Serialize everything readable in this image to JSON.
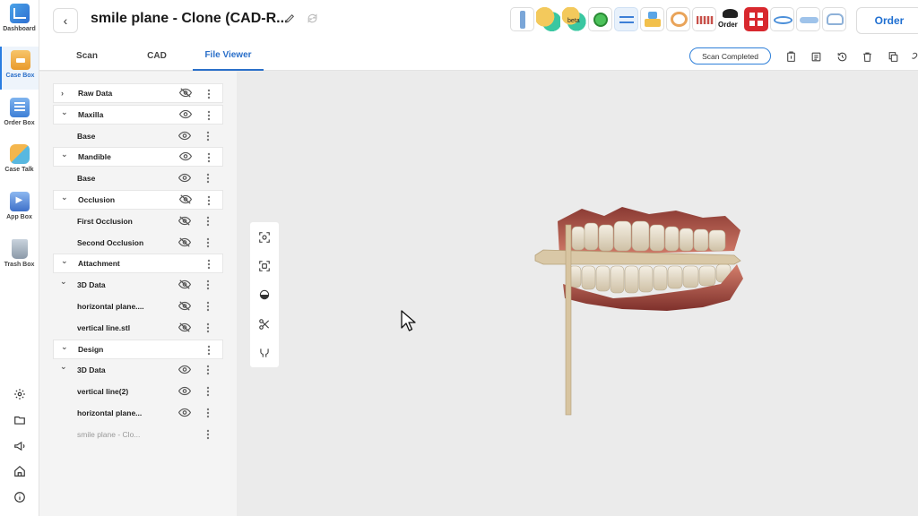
{
  "nav": {
    "items": [
      {
        "label": "Dashboard",
        "icon": "dashboard-icon"
      },
      {
        "label": "Case Box",
        "icon": "case-box-icon",
        "active": true
      },
      {
        "label": "Order Box",
        "icon": "order-box-icon"
      },
      {
        "label": "Case Talk",
        "icon": "case-talk-icon"
      },
      {
        "label": "App Box",
        "icon": "app-box-icon"
      },
      {
        "label": "Trash Box",
        "icon": "trash-box-icon"
      }
    ],
    "bottom_icons": [
      "settings-icon",
      "folder-icon",
      "megaphone-icon",
      "home-icon",
      "info-icon"
    ]
  },
  "header": {
    "back_icon": "chevron-left-icon",
    "title": "smile plane - Clone (CAD-R...",
    "edit_icon": "pencil-icon",
    "sync_icon": "sync-icon",
    "app_strip": [
      "app-scanner-icon",
      "app-green-icon",
      "app-beta-icon",
      "app-green-smile-icon",
      "app-workflow-icon",
      "app-ortho-icon",
      "app-arch-icon",
      "app-ruler-icon",
      "app-order-icon",
      "app-red-grid-icon",
      "app-lips-icon",
      "app-tray-icon",
      "app-tooth-icon"
    ],
    "beta_label": "beta",
    "order_app_label": "Order",
    "order_button": "Order"
  },
  "tabs": {
    "items": [
      "Scan",
      "CAD",
      "File Viewer"
    ],
    "active": "File Viewer",
    "status": "Scan Completed",
    "tool_icons": [
      "clipboard-icon",
      "note-icon",
      "history-icon",
      "delete-icon",
      "copy-icon",
      "link-icon"
    ]
  },
  "tree": [
    {
      "label": "Raw Data",
      "type": "group",
      "chevron": "chevron-right-icon",
      "eye": "eye-off"
    },
    {
      "label": "Maxilla",
      "type": "group",
      "chevron": "chevron-down-icon",
      "eye": "eye"
    },
    {
      "label": "Base",
      "type": "child",
      "eye": "eye"
    },
    {
      "label": "Mandible",
      "type": "group",
      "chevron": "chevron-down-icon",
      "eye": "eye"
    },
    {
      "label": "Base",
      "type": "child",
      "eye": "eye"
    },
    {
      "label": "Occlusion",
      "type": "group",
      "chevron": "chevron-down-icon",
      "eye": "eye-off"
    },
    {
      "label": "First Occlusion",
      "type": "child",
      "eye": "eye-off"
    },
    {
      "label": "Second Occlusion",
      "type": "child",
      "eye": "eye-off"
    },
    {
      "label": "Attachment",
      "type": "group",
      "chevron": "chevron-down-icon",
      "eye": "none"
    },
    {
      "label": "3D Data",
      "type": "subgroup",
      "chevron": "chevron-down-icon",
      "eye": "eye-off"
    },
    {
      "label": "horizontal plane....",
      "type": "child",
      "eye": "eye-off"
    },
    {
      "label": "vertical line.stl",
      "type": "child",
      "eye": "eye-off"
    },
    {
      "label": "Design",
      "type": "group",
      "chevron": "chevron-down-icon",
      "eye": "none"
    },
    {
      "label": "3D Data",
      "type": "subgroup",
      "chevron": "chevron-down-icon",
      "eye": "eye"
    },
    {
      "label": "vertical line(2)",
      "type": "child",
      "eye": "eye"
    },
    {
      "label": "horizontal plane...",
      "type": "child",
      "eye": "eye"
    },
    {
      "label": "smile plane - Clo...",
      "type": "child-dim",
      "eye": "none"
    }
  ],
  "viewport": {
    "tools": [
      "fit-view-icon",
      "focus-icon",
      "section-icon",
      "scissors-icon",
      "measure-icon"
    ],
    "cursor_icon": "mouse-pointer-icon"
  },
  "colors": {
    "accent": "#2a6fc9",
    "panel_bg": "#f4f4f4",
    "viewport_bg": "#ebebeb",
    "gum": "#c06b5c",
    "tooth": "#ece3d2",
    "plane": "#d8c7a6"
  }
}
